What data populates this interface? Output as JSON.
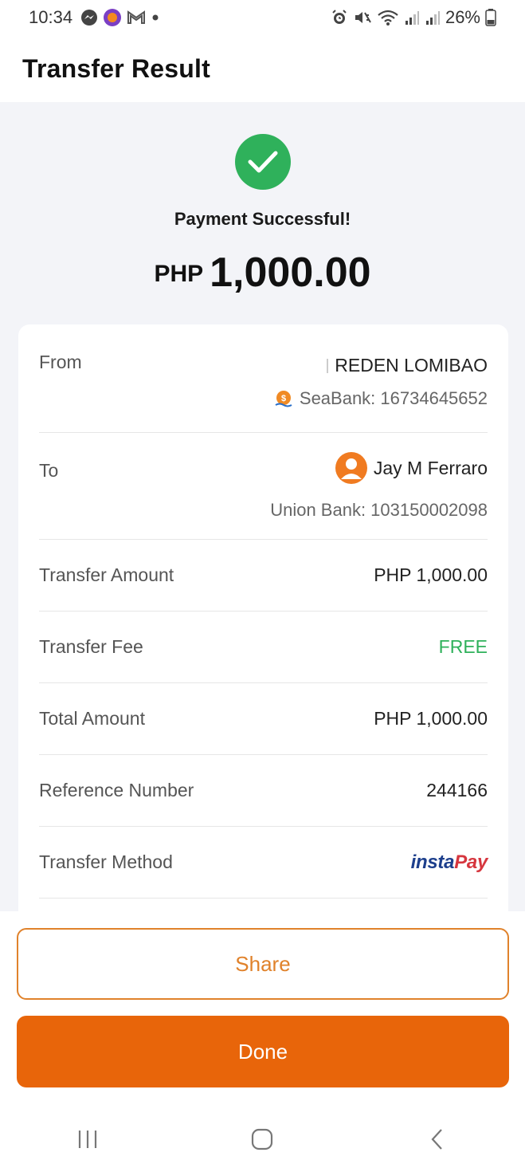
{
  "status_bar": {
    "time": "10:34",
    "battery": "26%",
    "left_icons": [
      "messenger-icon",
      "app-icon",
      "gmail-icon",
      "dot-icon"
    ],
    "right_icons": [
      "alarm-icon",
      "mute-icon",
      "wifi-icon",
      "signal-icon",
      "signal-icon",
      "battery-icon"
    ]
  },
  "header": {
    "title": "Transfer Result"
  },
  "result": {
    "message": "Payment Successful!",
    "currency": "PHP",
    "amount": "1,000.00"
  },
  "details": {
    "from": {
      "label": "From",
      "name": "REDEN LOMIBAO",
      "bank": "SeaBank: 16734645652"
    },
    "to": {
      "label": "To",
      "name": "Jay M Ferraro",
      "bank": "Union Bank: 103150002098"
    },
    "transfer_amount": {
      "label": "Transfer Amount",
      "value": "PHP 1,000.00"
    },
    "transfer_fee": {
      "label": "Transfer Fee",
      "value": "FREE"
    },
    "total_amount": {
      "label": "Total Amount",
      "value": "PHP 1,000.00"
    },
    "reference_number": {
      "label": "Reference Number",
      "value": "244166"
    },
    "transfer_method": {
      "label": "Transfer Method",
      "logo_insta": "insta",
      "logo_pay": "Pay"
    }
  },
  "buttons": {
    "share": "Share",
    "done": "Done"
  },
  "colors": {
    "accent": "#e8650a",
    "success": "#2fb15b",
    "outline": "#e0822b"
  }
}
